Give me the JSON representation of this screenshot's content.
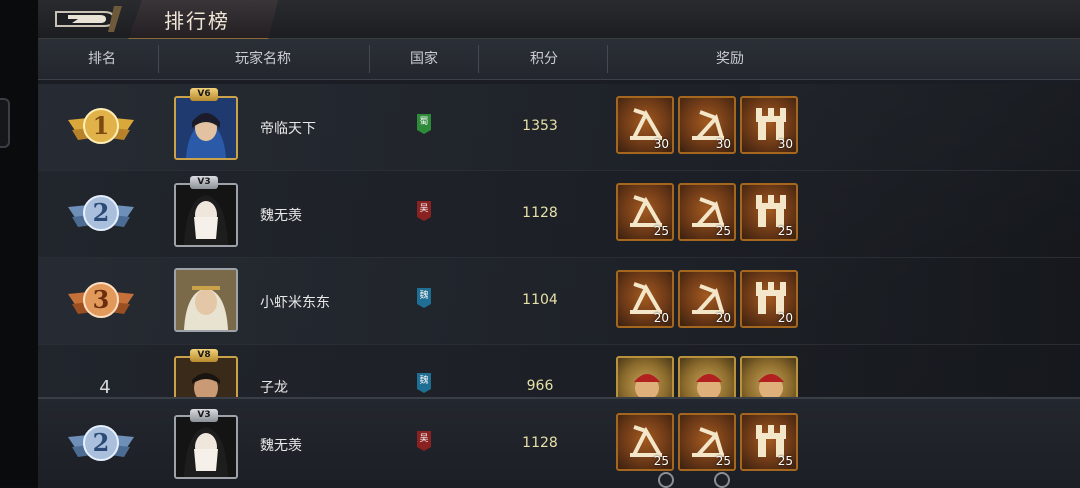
{
  "title": "排行榜",
  "columns": {
    "rank": "排名",
    "player": "玩家名称",
    "country": "国家",
    "score": "积分",
    "reward": "奖励"
  },
  "colors": {
    "accent": "#c9a24a",
    "score": "#e7e0a8",
    "shu": "#2e8b3a",
    "wu": "#8b2222",
    "wei": "#1f6f95"
  },
  "rows": [
    {
      "rank": "1",
      "vip": "V6",
      "name": "帝临天下",
      "country": "蜀",
      "score": "1353",
      "rewards": [
        {
          "icon": "catapult-icon",
          "qty": "30"
        },
        {
          "icon": "catapult-icon",
          "qty": "30"
        },
        {
          "icon": "tower-icon",
          "qty": "30"
        }
      ]
    },
    {
      "rank": "2",
      "vip": "V3",
      "name": "魏无羡",
      "country": "吴",
      "score": "1128",
      "rewards": [
        {
          "icon": "catapult-icon",
          "qty": "25"
        },
        {
          "icon": "catapult-icon",
          "qty": "25"
        },
        {
          "icon": "tower-icon",
          "qty": "25"
        }
      ]
    },
    {
      "rank": "3",
      "vip": "",
      "name": "小虾米东东",
      "country": "魏",
      "score": "1104",
      "rewards": [
        {
          "icon": "catapult-icon",
          "qty": "20"
        },
        {
          "icon": "catapult-icon",
          "qty": "20"
        },
        {
          "icon": "tower-icon",
          "qty": "20"
        }
      ]
    },
    {
      "rank": "4",
      "vip": "V8",
      "name": "子龙",
      "country": "魏",
      "score": "966",
      "rewards": [
        {
          "icon": "general-portrait-icon",
          "qty": ""
        },
        {
          "icon": "general-portrait-icon",
          "qty": ""
        },
        {
          "icon": "general-portrait-icon",
          "qty": ""
        }
      ]
    }
  ],
  "self_row": {
    "rank": "2",
    "vip": "V3",
    "name": "魏无羡",
    "country": "吴",
    "score": "1128",
    "rewards": [
      {
        "icon": "catapult-icon",
        "qty": "25"
      },
      {
        "icon": "catapult-icon",
        "qty": "25"
      },
      {
        "icon": "tower-icon",
        "qty": "25"
      }
    ]
  }
}
